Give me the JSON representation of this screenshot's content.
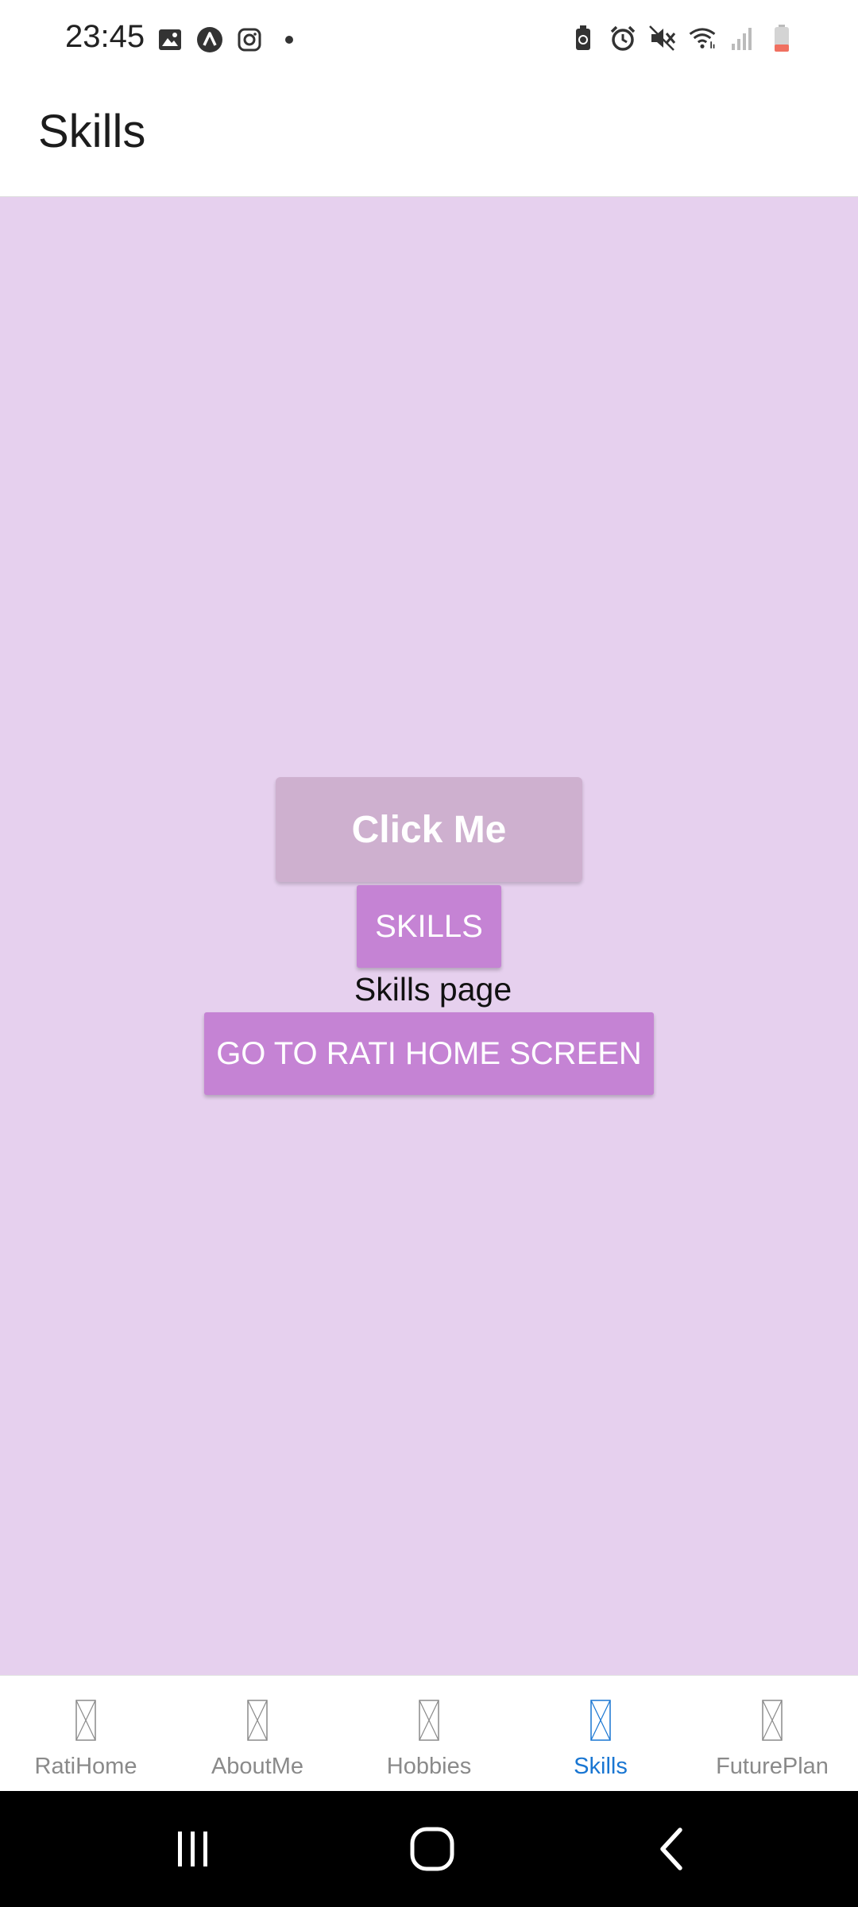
{
  "status_bar": {
    "time": "23:45",
    "left_icons": [
      "image-icon",
      "app-a-icon",
      "instagram-icon",
      "dot-icon"
    ],
    "right_icons": [
      "battery-saver-icon",
      "alarm-icon",
      "mute-icon",
      "wifi-icon",
      "signal-icon",
      "battery-icon"
    ]
  },
  "header": {
    "title": "Skills"
  },
  "main": {
    "click_me_label": "Click Me",
    "skills_button_label": "SKILLS",
    "page_text": "Skills page",
    "go_home_label": "GO TO RATI HOME SCREEN"
  },
  "tabs": [
    {
      "label": "RatiHome",
      "icon": "missing-glyph-icon",
      "active": false
    },
    {
      "label": "AboutMe",
      "icon": "missing-glyph-icon",
      "active": false
    },
    {
      "label": "Hobbies",
      "icon": "missing-glyph-icon",
      "active": false
    },
    {
      "label": "Skills",
      "icon": "missing-glyph-icon",
      "active": true
    },
    {
      "label": "FuturePlan",
      "icon": "missing-glyph-icon",
      "active": false
    }
  ],
  "system_nav": [
    "recents-icon",
    "home-icon",
    "back-icon"
  ],
  "colors": {
    "content_background": "#e6d0ee",
    "button_primary": "#c583d4",
    "button_disabled": "#ceb0cf",
    "tab_active": "#1976d2",
    "tab_inactive": "#8a8a8a"
  }
}
